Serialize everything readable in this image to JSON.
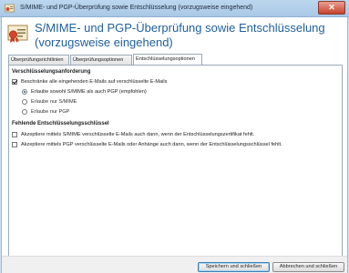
{
  "window": {
    "title": "S/MIME- und PGP-Überprüfung sowie Entschlüsselung (vorzugsweise eingehend)",
    "close_label": "✕"
  },
  "header": {
    "title": "S/MIME- und PGP-Überprüfung sowie Entschlüsselung (vorzugsweise eingehend)",
    "icon": "certificate-seal-icon"
  },
  "tabs": [
    {
      "label": "Überprüfungsrichtlinien"
    },
    {
      "label": "Überprüfungsoptionen"
    },
    {
      "label": "Entschlüsselungsoptionen",
      "active": true
    }
  ],
  "sections": {
    "requirement": {
      "title": "Verschlüsselungsanforderung",
      "restrict_checkbox": {
        "label": "Beschränke alle eingehenden E-Mails auf verschlüsselte E-Mails",
        "checked": true
      },
      "radios": [
        {
          "label": "Erlaube sowohl S/MIME als auch PGP (empfohlen)",
          "checked": true
        },
        {
          "label": "Erlaube nur S/MIME",
          "checked": false
        },
        {
          "label": "Erlaube nur PGP",
          "checked": false
        }
      ]
    },
    "missing_key": {
      "title": "Fehlende Entschlüsselungsschlüssel",
      "options": [
        {
          "label": "Akzeptiere mittels S/MIME verschlüsselte E-Mails auch dann, wenn der Entschlüsselungszertifikat fehlt.",
          "checked": false
        },
        {
          "label": "Akzeptiere mittels PGP verschlüsselte E-Mails oder Anhänge auch dann, wenn der Entschlüsselungsschlüssel fehlt.",
          "checked": false
        }
      ]
    }
  },
  "footer": {
    "save_label": "Speichern und schließen",
    "cancel_label": "Abbrechen und schließen"
  },
  "colors": {
    "heading": "#1f5f9c",
    "titlebar": "#bcd6ee",
    "close": "#c7412a"
  }
}
